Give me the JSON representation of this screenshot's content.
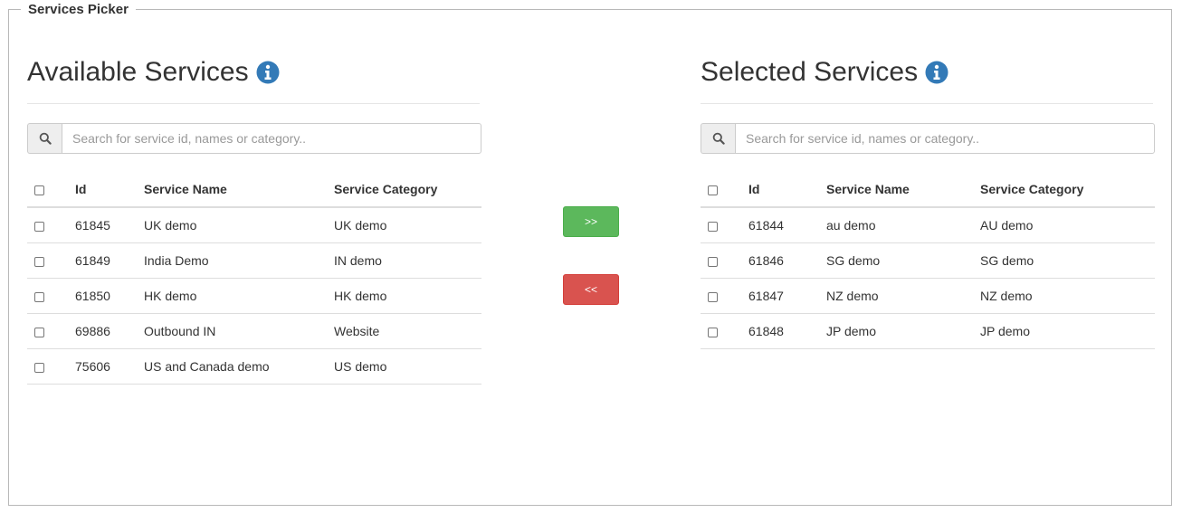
{
  "picker": {
    "legend": "Services Picker"
  },
  "available": {
    "title": "Available Services",
    "search_placeholder": "Search for service id, names or category..",
    "columns": {
      "id": "Id",
      "name": "Service Name",
      "category": "Service Category"
    },
    "rows": [
      {
        "id": "61845",
        "name": "UK demo",
        "category": "UK demo"
      },
      {
        "id": "61849",
        "name": "India Demo",
        "category": "IN demo"
      },
      {
        "id": "61850",
        "name": "HK demo",
        "category": "HK demo"
      },
      {
        "id": "69886",
        "name": "Outbound IN",
        "category": "Website"
      },
      {
        "id": "75606",
        "name": "US and Canada demo",
        "category": "US demo"
      }
    ]
  },
  "selected": {
    "title": "Selected Services",
    "search_placeholder": "Search for service id, names or category..",
    "columns": {
      "id": "Id",
      "name": "Service Name",
      "category": "Service Category"
    },
    "rows": [
      {
        "id": "61844",
        "name": "au demo",
        "category": "AU demo"
      },
      {
        "id": "61846",
        "name": "SG demo",
        "category": "SG demo"
      },
      {
        "id": "61847",
        "name": "NZ demo",
        "category": "NZ demo"
      },
      {
        "id": "61848",
        "name": "JP demo",
        "category": "JP demo"
      }
    ]
  },
  "actions": {
    "add_label": ">>",
    "remove_label": "<<"
  },
  "icons": {
    "info": "info-icon",
    "search": "search-icon"
  },
  "colors": {
    "info_icon": "#337ab7",
    "add_button": "#5cb85c",
    "remove_button": "#d9534f"
  }
}
